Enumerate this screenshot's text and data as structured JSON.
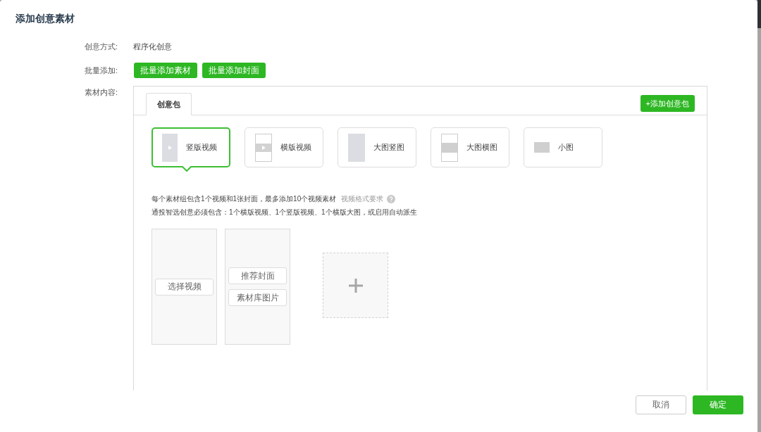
{
  "dialog": {
    "title": "添加创意素材"
  },
  "form": {
    "method_label": "创意方式:",
    "method_value": "程序化创意",
    "batch_label": "批量添加:",
    "batch_buttons": [
      "批量添加素材",
      "批量添加封面"
    ],
    "content_label": "素材内容:"
  },
  "material": {
    "tabs": [
      {
        "label": "创意包",
        "selected": true
      }
    ],
    "add_pack_button": "+添加创意包",
    "formats": [
      {
        "kind": "vertical-video",
        "label": "竖版视频",
        "selected": true
      },
      {
        "kind": "horizontal-video",
        "label": "横版视频",
        "selected": false
      },
      {
        "kind": "large-vertical",
        "label": "大图竖图",
        "selected": false
      },
      {
        "kind": "large-horizontal",
        "label": "大图横图",
        "selected": false
      },
      {
        "kind": "small",
        "label": "小图",
        "selected": false
      }
    ],
    "note_1": "每个素材组包含1个视频和1张封面，最多添加10个视频素材",
    "format_link": "视频格式要求",
    "note_2": "通投智选创意必须包含：1个横版视频、1个竖版视频、1个横版大图，或启用自动派生",
    "video_slot_button": "选择视频",
    "cover_slot_buttons": [
      "推荐封面",
      "素材库图片"
    ]
  },
  "footer": {
    "cancel": "取消",
    "confirm": "确定"
  }
}
